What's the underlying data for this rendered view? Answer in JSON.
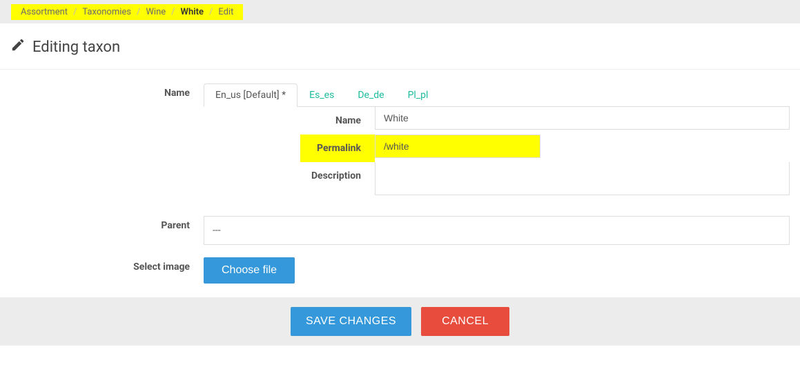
{
  "breadcrumb": {
    "items": [
      {
        "label": "Assortment",
        "active": false
      },
      {
        "label": "Taxonomies",
        "active": false
      },
      {
        "label": "Wine",
        "active": false
      },
      {
        "label": "White",
        "active": true
      },
      {
        "label": "Edit",
        "active": false
      }
    ]
  },
  "header": {
    "title": "Editing taxon"
  },
  "form": {
    "name_label": "Name",
    "tabs": [
      {
        "label": "En_us [Default] *",
        "active": true
      },
      {
        "label": "Es_es",
        "active": false
      },
      {
        "label": "De_de",
        "active": false
      },
      {
        "label": "Pl_pl",
        "active": false
      }
    ],
    "fields": {
      "name": {
        "label": "Name",
        "value": "White"
      },
      "permalink": {
        "label": "Permalink",
        "value": "/white",
        "highlight": true
      },
      "description": {
        "label": "Description",
        "value": ""
      }
    },
    "parent": {
      "label": "Parent",
      "value": "---"
    },
    "image": {
      "label": "Select image",
      "button": "Choose file"
    }
  },
  "footer": {
    "save": "SAVE CHANGES",
    "cancel": "CANCEL"
  }
}
